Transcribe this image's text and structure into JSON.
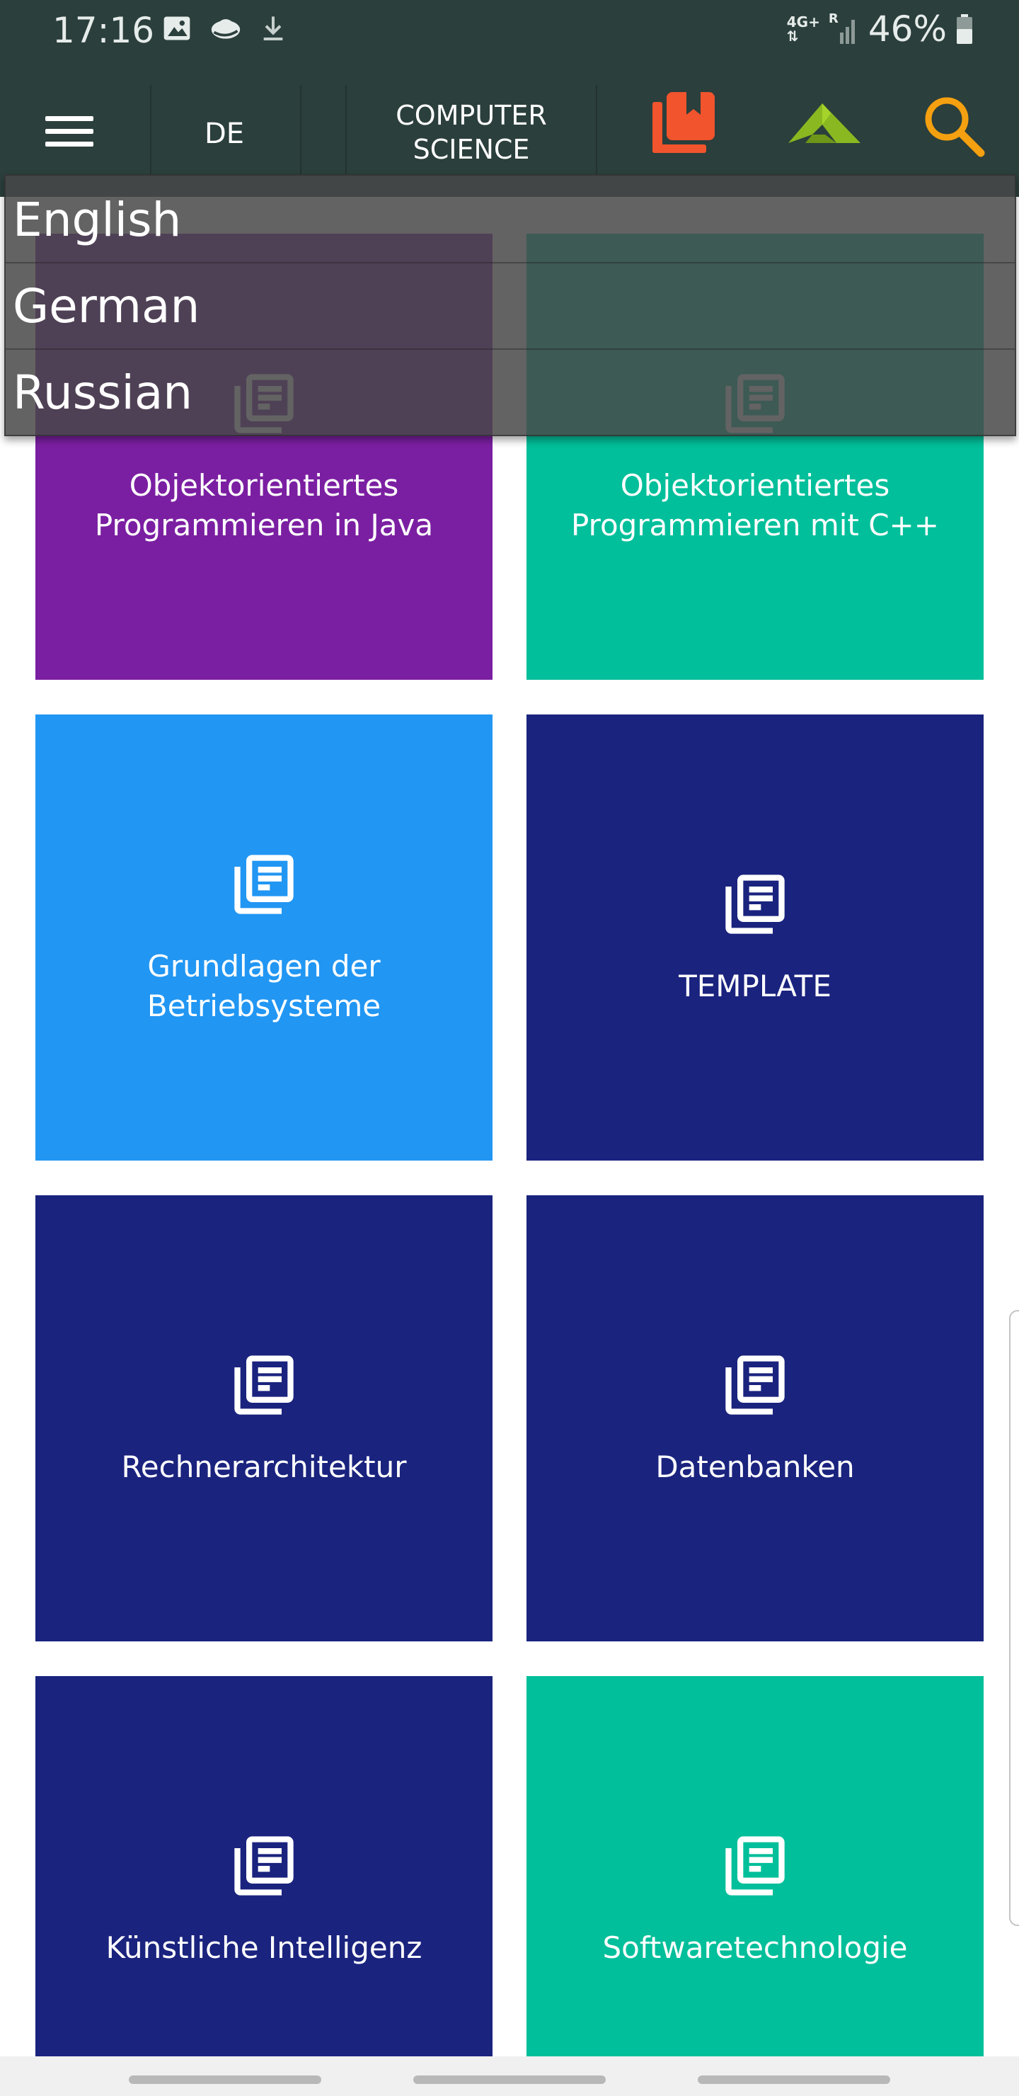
{
  "status_bar": {
    "time": "17:16",
    "network_label": "4G+",
    "roaming_label": "R",
    "battery_percent": "46%",
    "left_icons": [
      "image-icon",
      "cloud-icon",
      "download-icon"
    ]
  },
  "toolbar": {
    "language_code": "DE",
    "category_title": "COMPUTER\nSCIENCE",
    "menu_icon": "hamburger-menu-icon",
    "library_icon": "book-library-icon",
    "logo_icon": "app-logo-icon",
    "search_icon": "search-icon",
    "colors": {
      "background": "#2b3f3c",
      "library": "#f2542d",
      "logo": "#8ab820",
      "search": "#f5a010"
    }
  },
  "language_dropdown": {
    "options": [
      "English",
      "German",
      "Russian"
    ]
  },
  "tiles": [
    {
      "label": "Objektorientiertes\nProgrammieren in Java",
      "color": "#7b1fa2",
      "icon": "document-list-icon"
    },
    {
      "label": "Objektorientiertes\nProgrammieren mit C++",
      "color": "#00bf9a",
      "icon": "document-list-icon"
    },
    {
      "label": "Grundlagen der\nBetriebsysteme",
      "color": "#2196f3",
      "icon": "document-list-icon"
    },
    {
      "label": "TEMPLATE",
      "color": "#1a237e",
      "icon": "document-list-icon"
    },
    {
      "label": "Rechnerarchitektur",
      "color": "#1a237e",
      "icon": "document-list-icon"
    },
    {
      "label": "Datenbanken",
      "color": "#1a237e",
      "icon": "document-list-icon"
    },
    {
      "label": "Künstliche Intelligenz",
      "color": "#1a237e",
      "icon": "document-list-icon"
    },
    {
      "label": "Softwaretechnologie",
      "color": "#00bf9a",
      "icon": "document-list-icon"
    }
  ]
}
